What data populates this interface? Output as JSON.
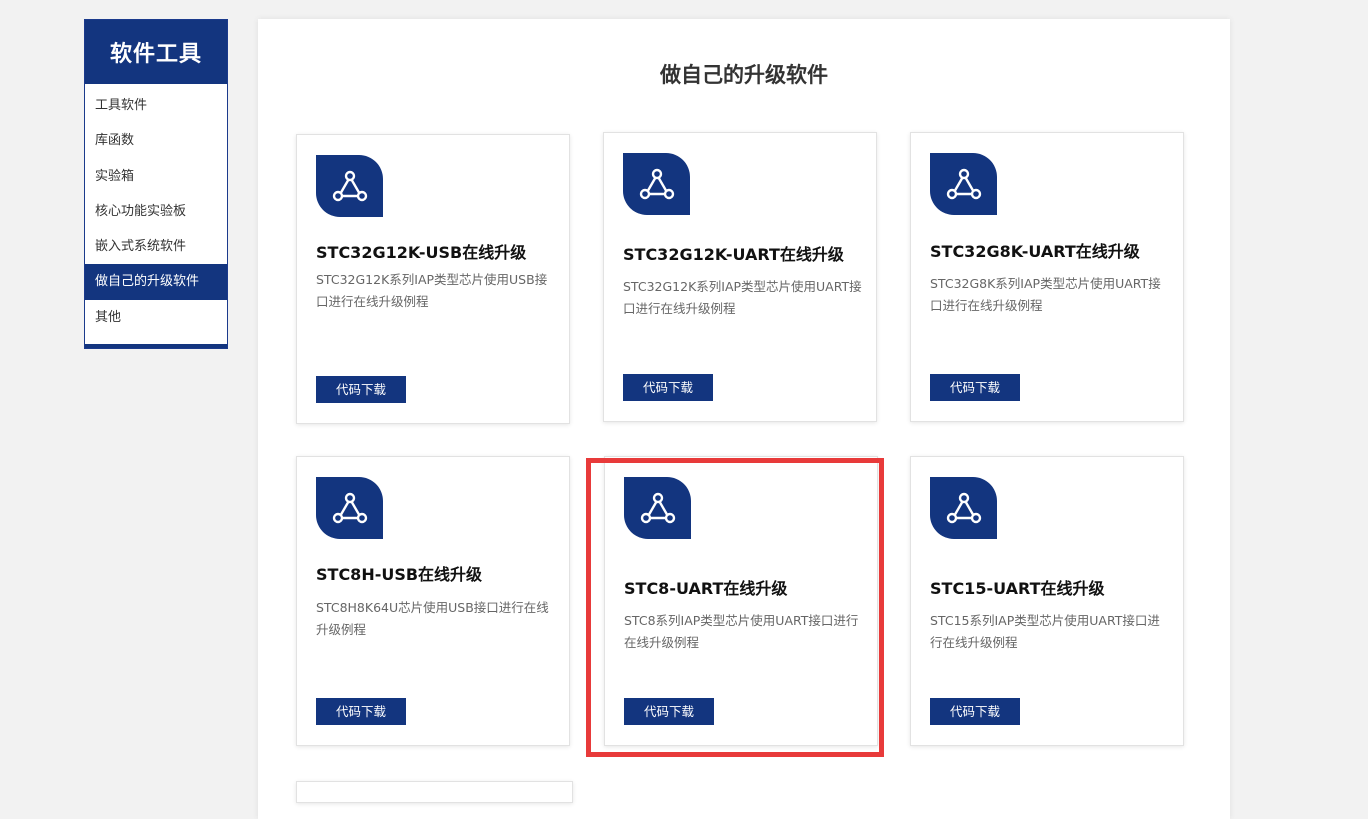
{
  "sidebar": {
    "title": "软件工具",
    "items": [
      {
        "label": "工具软件"
      },
      {
        "label": "库函数"
      },
      {
        "label": "实验箱"
      },
      {
        "label": "核心功能实验板"
      },
      {
        "label": "嵌入式系统软件"
      },
      {
        "label": "做自己的升级软件"
      },
      {
        "label": "其他"
      }
    ],
    "active_item": "做自己的升级软件"
  },
  "main": {
    "title": "做自己的升级软件",
    "cards": [
      {
        "icon": "network-triangle-icon",
        "title": "STC32G12K-USB在线升级",
        "desc": "STC32G12K系列IAP类型芯片使用USB接口进行在线升级例程",
        "button": "代码下载"
      },
      {
        "icon": "network-triangle-icon",
        "title": "STC32G12K-UART在线升级",
        "desc": "STC32G12K系列IAP类型芯片使用UART接口进行在线升级例程",
        "button": "代码下载"
      },
      {
        "icon": "network-triangle-icon",
        "title": "STC32G8K-UART在线升级",
        "desc": "STC32G8K系列IAP类型芯片使用UART接口进行在线升级例程",
        "button": "代码下载"
      },
      {
        "icon": "network-triangle-icon",
        "title": "STC8H-USB在线升级",
        "desc": "STC8H8K64U芯片使用USB接口进行在线升级例程",
        "button": "代码下载"
      },
      {
        "icon": "network-triangle-icon",
        "title": "STC8-UART在线升级",
        "desc": "STC8系列IAP类型芯片使用UART接口进行在线升级例程",
        "button": "代码下载"
      },
      {
        "icon": "network-triangle-icon",
        "title": "STC15-UART在线升级",
        "desc": "STC15系列IAP类型芯片使用UART接口进行在线升级例程",
        "button": "代码下载"
      }
    ]
  },
  "colors": {
    "brand": "#13357f",
    "highlight": "#e83a3a",
    "background": "#f2f2f2"
  }
}
